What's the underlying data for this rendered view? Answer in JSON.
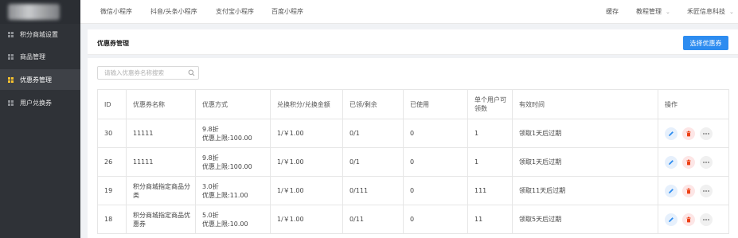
{
  "sidebar": {
    "items": [
      {
        "label": "积分商城设置",
        "icon": "grid-icon",
        "active": false
      },
      {
        "label": "商品管理",
        "icon": "grid-icon",
        "active": false
      },
      {
        "label": "优惠券管理",
        "icon": "grid-icon",
        "active": true
      },
      {
        "label": "用户兑换券",
        "icon": "grid-icon",
        "active": false
      }
    ]
  },
  "topbar": {
    "tabs": [
      "微信小程序",
      "抖音/头条小程序",
      "支付宝小程序",
      "百度小程序"
    ],
    "cache": "缓存",
    "tutorial": "教程管理",
    "company": "禾匠信息科技"
  },
  "panel": {
    "title": "优惠券管理",
    "select_button": "选择优惠券"
  },
  "search": {
    "placeholder": "请输入优惠券名称搜索"
  },
  "table": {
    "headers": [
      "ID",
      "优惠券名称",
      "优惠方式",
      "兑换积分/兑换金额",
      "已领/剩余",
      "已使用",
      "单个用户可领数",
      "有效时间",
      "操作"
    ],
    "rows": [
      {
        "id": "30",
        "name": "11111",
        "discount": [
          "9.8折",
          "优惠上限:100.00"
        ],
        "exchange": "1/￥1.00",
        "claimed": "0/1",
        "used": "0",
        "per_user": "1",
        "validity": "领取1天后过期"
      },
      {
        "id": "26",
        "name": "11111",
        "discount": [
          "9.8折",
          "优惠上限:100.00"
        ],
        "exchange": "1/￥1.00",
        "claimed": "0/1",
        "used": "0",
        "per_user": "1",
        "validity": "领取1天后过期"
      },
      {
        "id": "19",
        "name": "积分商城指定商品分类",
        "discount": [
          "3.0折",
          "优惠上限:11.00"
        ],
        "exchange": "1/￥1.00",
        "claimed": "0/111",
        "used": "0",
        "per_user": "111",
        "validity": "领取11天后过期"
      },
      {
        "id": "18",
        "name": "积分商城指定商品优惠券",
        "discount": [
          "5.0折",
          "优惠上限:10.00"
        ],
        "exchange": "1/￥1.00",
        "claimed": "0/11",
        "used": "0",
        "per_user": "11",
        "validity": "领取5天后过期"
      }
    ]
  },
  "colors": {
    "sidebar_bg": "#2f3237",
    "accent": "#2d8cf0",
    "active_icon": "#f5c12e",
    "delete": "#ed4014"
  }
}
